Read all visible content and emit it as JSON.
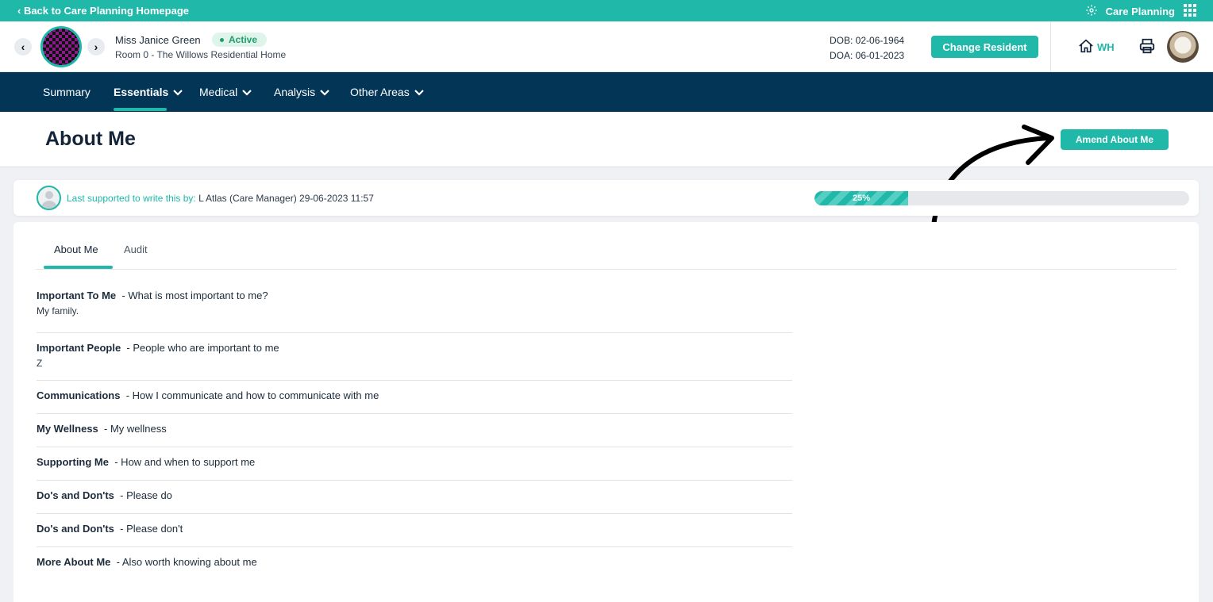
{
  "topbar": {
    "back_label": "‹ Back to Care Planning Homepage",
    "app_label": "Care Planning"
  },
  "header": {
    "resident_name": "Miss Janice Green",
    "status": "Active",
    "room": "Room 0 - The Willows Residential Home",
    "dob": "DOB: 02-06-1964",
    "doa": "DOA: 06-01-2023",
    "change_resident_label": "Change Resident",
    "home_code": "WH",
    "colors": {
      "accent": "#1fb8a9",
      "status_green": "#1f9d6b"
    }
  },
  "nav": {
    "items": [
      {
        "label": "Summary",
        "dropdown": false
      },
      {
        "label": "Essentials",
        "dropdown": true,
        "active": true
      },
      {
        "label": "Medical",
        "dropdown": true
      },
      {
        "label": "Analysis",
        "dropdown": true
      },
      {
        "label": "Other Areas",
        "dropdown": true
      }
    ],
    "background": "#033557"
  },
  "page": {
    "title": "About Me",
    "amend_label": "Amend About Me"
  },
  "support": {
    "label": "Last supported to write this by:",
    "value": "L Atlas (Care Manager) 29-06-2023 11:57",
    "progress_percent": 25,
    "progress_label": "25%"
  },
  "tabs": [
    {
      "label": "About Me",
      "active": true
    },
    {
      "label": "Audit",
      "active": false
    }
  ],
  "sections": [
    {
      "title": "Important To Me",
      "prompt": "- What is most important to me?",
      "content": "My family."
    },
    {
      "title": "Important People",
      "prompt": "- People who are important to me",
      "content": "Z"
    },
    {
      "title": "Communications",
      "prompt": "- How I communicate and how to communicate with me",
      "content": ""
    },
    {
      "title": "My Wellness",
      "prompt": "- My wellness",
      "content": ""
    },
    {
      "title": "Supporting Me",
      "prompt": "- How and when to support me",
      "content": ""
    },
    {
      "title": "Do's and Don'ts",
      "prompt": "- Please do",
      "content": ""
    },
    {
      "title": "Do's and Don'ts",
      "prompt": "- Please don't",
      "content": ""
    },
    {
      "title": "More About Me",
      "prompt": "- Also worth knowing about me",
      "content": ""
    }
  ]
}
